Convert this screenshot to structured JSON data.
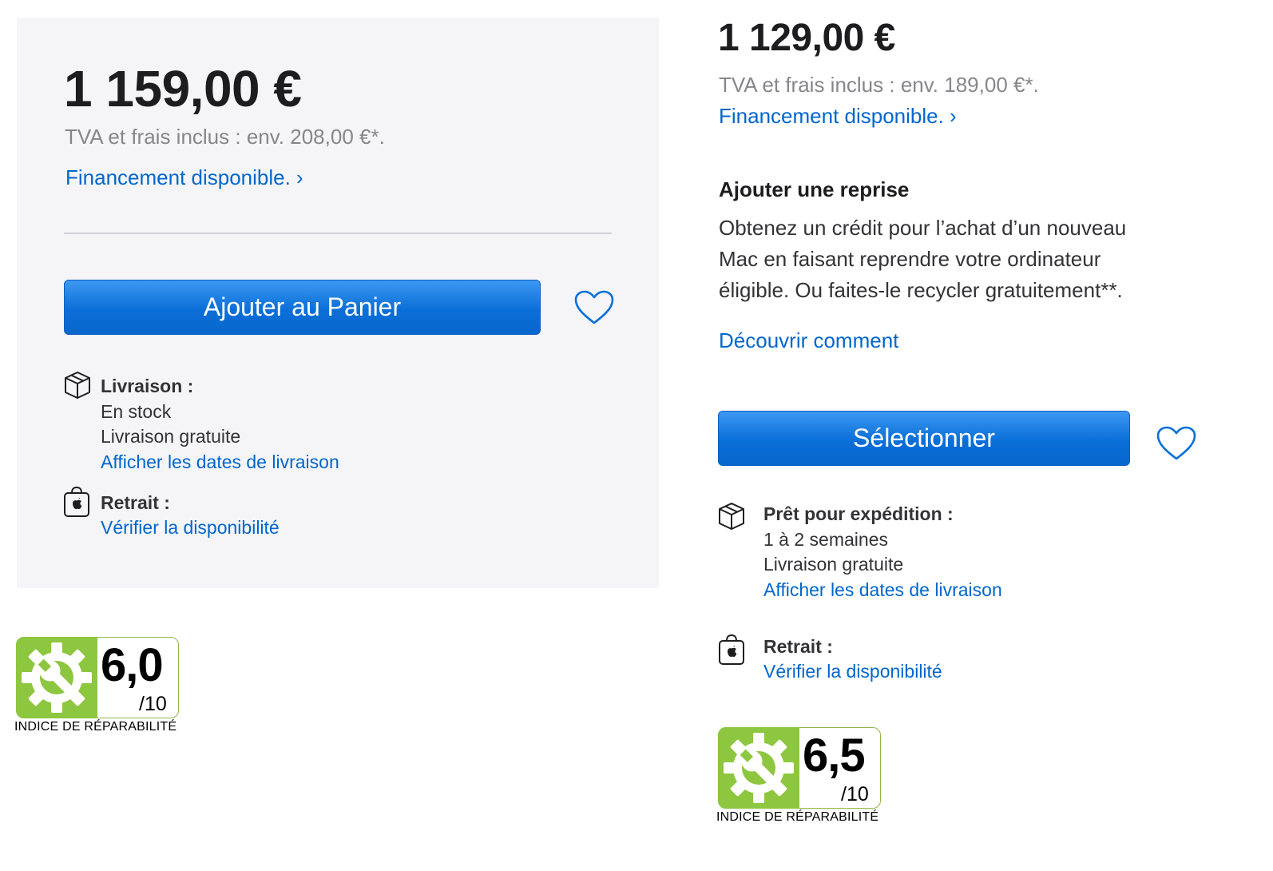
{
  "left": {
    "price": "1 159,00 €",
    "tax": "TVA et frais inclus : env. 208,00 €*.",
    "financing_link": "Financement disponible. ›",
    "add_to_cart": "Ajouter au Panier",
    "delivery": {
      "title": "Livraison :",
      "status": "En stock",
      "shipping": "Livraison gratuite",
      "dates_link": "Afficher les dates de livraison"
    },
    "pickup": {
      "title": "Retrait :",
      "link": "Vérifier la disponibilité"
    },
    "repairability": {
      "score": "6,0",
      "scale": "/10",
      "caption": "INDICE DE RÉPARABILITÉ"
    }
  },
  "right": {
    "price": "1 129,00 €",
    "tax": "TVA et frais inclus : env. 189,00 €*.",
    "financing_link": "Financement disponible. ›",
    "tradein": {
      "title": "Ajouter une reprise",
      "line1": "Obtenez un crédit pour l’achat d’un nouveau",
      "line2": "Mac en faisant reprendre votre ordinateur",
      "line3": "éligible. Ou faites-le recycler gratuitement**.",
      "link": "Découvrir comment"
    },
    "select": "Sélectionner",
    "shipping": {
      "title": "Prêt pour expédition :",
      "status": "1 à 2 semaines",
      "shipping": "Livraison gratuite",
      "dates_link": "Afficher les dates de livraison"
    },
    "pickup": {
      "title": "Retrait :",
      "link": "Vérifier la disponibilité"
    },
    "repairability": {
      "score": "6,5",
      "scale": "/10",
      "caption": "INDICE DE RÉPARABILITÉ"
    }
  },
  "colors": {
    "accent_link": "#0066cc",
    "button": "#0a6fd8",
    "panel_bg": "#f5f5f7",
    "badge_green": "#8dc63f"
  },
  "icons": [
    "box-icon",
    "apple-bag-icon",
    "heart-icon",
    "wrench-gear-icon"
  ]
}
